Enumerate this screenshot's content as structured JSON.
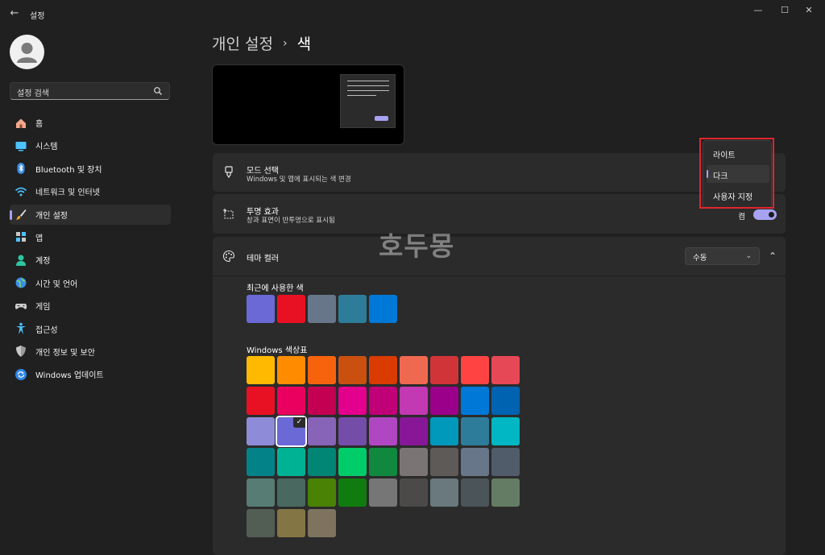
{
  "window": {
    "app_title": "설정",
    "back_glyph": "←",
    "minimize_glyph": "—",
    "maximize_glyph": "☐",
    "close_glyph": "✕"
  },
  "sidebar": {
    "search_placeholder": "설정 검색",
    "items": [
      {
        "label": "홈",
        "icon": "home-icon"
      },
      {
        "label": "시스템",
        "icon": "system-icon"
      },
      {
        "label": "Bluetooth 및 장치",
        "icon": "bluetooth-icon"
      },
      {
        "label": "네트워크 및 인터넷",
        "icon": "wifi-icon"
      },
      {
        "label": "개인 설정",
        "icon": "brush-icon",
        "active": true
      },
      {
        "label": "앱",
        "icon": "apps-icon"
      },
      {
        "label": "계정",
        "icon": "account-icon"
      },
      {
        "label": "시간 및 언어",
        "icon": "globe-icon"
      },
      {
        "label": "게임",
        "icon": "gamepad-icon"
      },
      {
        "label": "접근성",
        "icon": "accessibility-icon"
      },
      {
        "label": "개인 정보 및 보안",
        "icon": "shield-icon"
      },
      {
        "label": "Windows 업데이트",
        "icon": "update-icon"
      }
    ]
  },
  "breadcrumb": {
    "parent": "개인 설정",
    "separator": "›",
    "current": "색"
  },
  "mode_card": {
    "title": "모드 선택",
    "subtitle": "Windows 및 앱에 표시되는 색 변경"
  },
  "transparency_card": {
    "title": "투명 효과",
    "subtitle": "창과 표면이 반투명으로 표시됨",
    "toggle_label": "켬",
    "toggle_on": true
  },
  "theme_card": {
    "title": "테마 컬러",
    "dropdown_value": "수동",
    "chevron_down": "⌄",
    "collapse_glyph": "⌃",
    "recent_label": "최근에 사용한 색",
    "palette_label": "Windows 색상표",
    "check_glyph": "✓",
    "recent_colors": [
      "#6b69d6",
      "#e81123",
      "#68768a",
      "#2d7d9a",
      "#0078d7"
    ],
    "palette_rows": [
      [
        "#ffb900",
        "#ff8c00",
        "#f7630c",
        "#ca5010",
        "#da3b01",
        "#ef6950",
        "#d13438",
        "#ff4343",
        "#e74856"
      ],
      [
        "#e81123",
        "#ea005e",
        "#c30052",
        "#e3008c",
        "#bf0077",
        "#c239b3",
        "#9a0089",
        "#0078d7",
        "#0063b1"
      ],
      [
        "#8e8cd8",
        "#6b69d6",
        "#8764b8",
        "#744da9",
        "#b146c2",
        "#881798",
        "#0099bc",
        "#2d7d9a",
        "#00b7c3"
      ],
      [
        "#038387",
        "#00b294",
        "#018574",
        "#00cc6a",
        "#10893e",
        "#7a7574",
        "#5d5a58",
        "#68768a",
        "#515c6b"
      ],
      [
        "#567c73",
        "#486860",
        "#498205",
        "#107c10",
        "#767676",
        "#4c4a48",
        "#69797e",
        "#4a5459",
        "#647c64"
      ],
      [
        "#525e54",
        "#847545",
        "#7e735f"
      ]
    ],
    "selected_palette_color": "#6b69d6"
  },
  "mode_flyout": {
    "options": [
      "라이트",
      "다크",
      "사용자 지정"
    ],
    "selected": "다크"
  },
  "watermark": "호두몽",
  "colors": {
    "accent": "#a8a2f2",
    "highlight": "#e0252e"
  }
}
